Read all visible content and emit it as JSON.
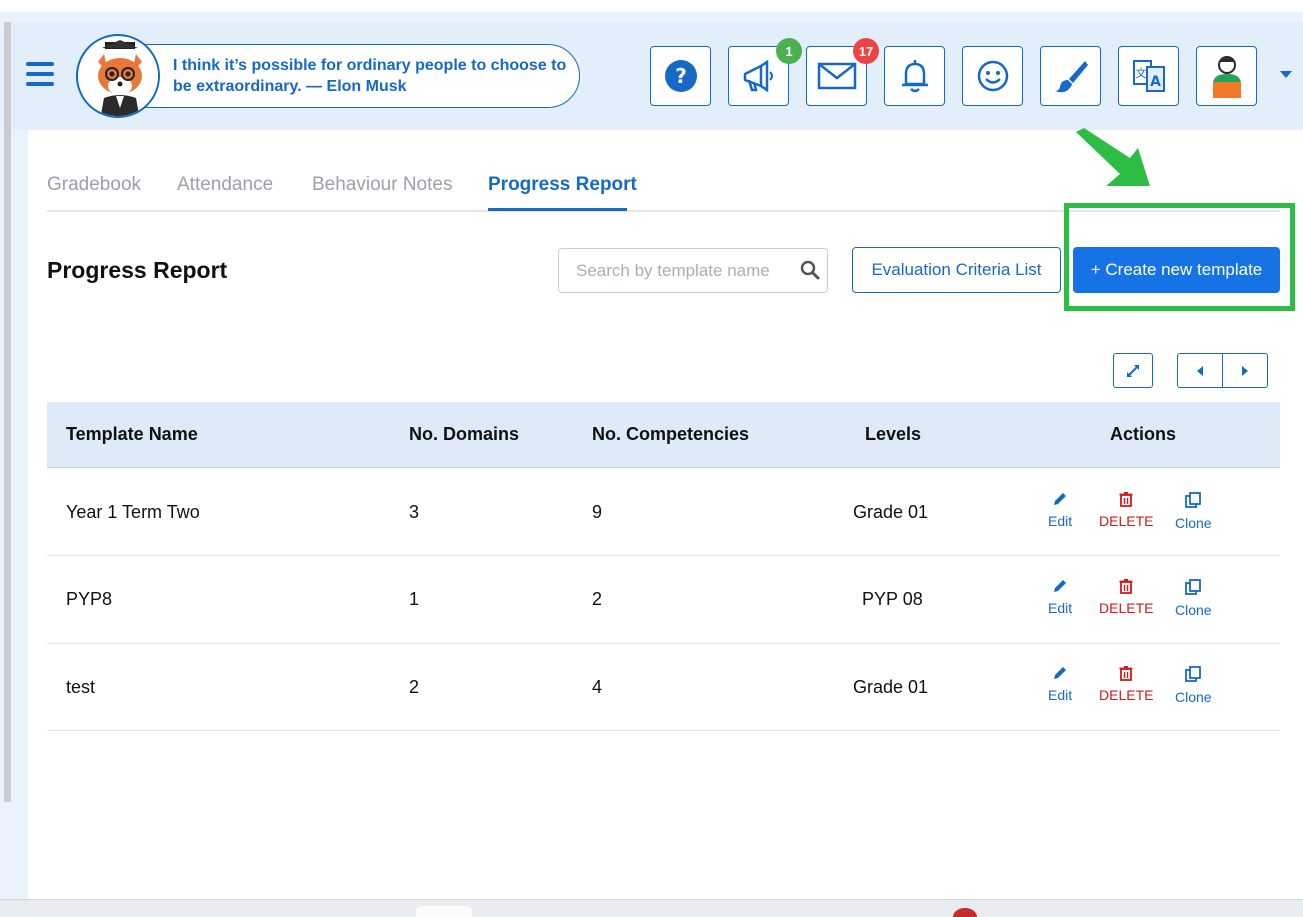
{
  "header": {
    "quote": "I think it’s possible for ordinary people to choose to be extraordinary. — Elon Musk",
    "icons": [
      {
        "name": "help-icon"
      },
      {
        "name": "announcement-icon",
        "badge": "1",
        "badge_color": "#4caf50"
      },
      {
        "name": "mail-icon",
        "badge": "17",
        "badge_color": "#ef4444"
      },
      {
        "name": "bell-icon"
      },
      {
        "name": "smiley-icon"
      },
      {
        "name": "paintbrush-icon"
      },
      {
        "name": "translate-icon"
      },
      {
        "name": "user-avatar-icon"
      }
    ]
  },
  "tabs": [
    {
      "label": "Gradebook",
      "active": false
    },
    {
      "label": "Attendance",
      "active": false
    },
    {
      "label": "Behaviour Notes",
      "active": false
    },
    {
      "label": "Progress Report",
      "active": true
    }
  ],
  "page": {
    "title": "Progress Report",
    "search_placeholder": "Search by template name",
    "evaluation_button": "Evaluation Criteria List",
    "create_button": "+ Create new template"
  },
  "table": {
    "headers": [
      "Template Name",
      "No. Domains",
      "No. Competencies",
      "Levels",
      "Actions"
    ],
    "rows": [
      {
        "name": "Year 1 Term Two",
        "domains": "3",
        "competencies": "9",
        "levels": "Grade 01"
      },
      {
        "name": "PYP8",
        "domains": "1",
        "competencies": "2",
        "levels": "PYP 08"
      },
      {
        "name": "test",
        "domains": "2",
        "competencies": "4",
        "levels": "Grade 01"
      }
    ],
    "actions": {
      "edit": "Edit",
      "delete": "DELETE",
      "clone": "Clone"
    }
  },
  "colors": {
    "brand": "#1769c6",
    "primary_button": "#1573e6",
    "highlight": "#2dbd45",
    "delete": "#d11a1a"
  }
}
